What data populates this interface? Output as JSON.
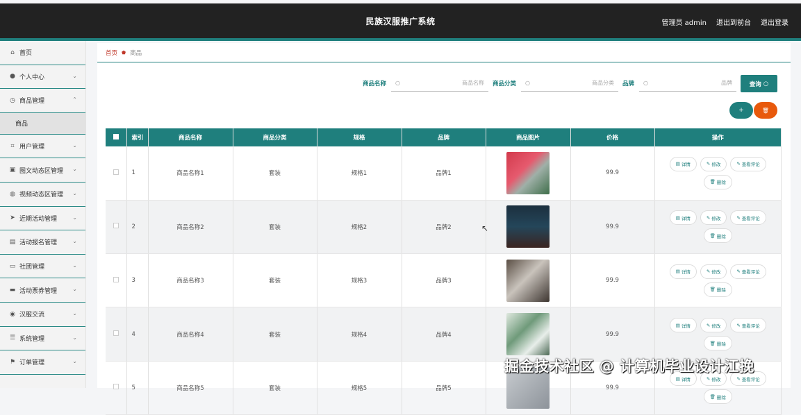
{
  "header": {
    "title": "民族汉服推广系统",
    "admin": "管理员 admin",
    "exit_front": "退出到前台",
    "logout": "退出登录"
  },
  "sidebar": {
    "items": [
      {
        "label": "首页",
        "icon": "home-icon",
        "glyph": "⌂",
        "chevron": false
      },
      {
        "label": "个人中心",
        "icon": "user-icon",
        "glyph": "●",
        "chevron": true
      },
      {
        "label": "商品管理",
        "icon": "clock-icon",
        "glyph": "◷",
        "chevron": true,
        "open": true
      },
      {
        "label": "用户管理",
        "icon": "crop-icon",
        "glyph": "⌗",
        "chevron": true
      },
      {
        "label": "图文动态区管理",
        "icon": "image-icon",
        "glyph": "▣",
        "chevron": true
      },
      {
        "label": "视频动态区管理",
        "icon": "globe-icon",
        "glyph": "◍",
        "chevron": true
      },
      {
        "label": "近期活动管理",
        "icon": "send-icon",
        "glyph": "➤",
        "chevron": true
      },
      {
        "label": "活动报名管理",
        "icon": "chart-icon",
        "glyph": "▤",
        "chevron": true
      },
      {
        "label": "社团管理",
        "icon": "chat-icon",
        "glyph": "▭",
        "chevron": true
      },
      {
        "label": "活动票券管理",
        "icon": "monitor-icon",
        "glyph": "▬",
        "chevron": true
      },
      {
        "label": "汉服交流",
        "icon": "mic-icon",
        "glyph": "◉",
        "chevron": true
      },
      {
        "label": "系统管理",
        "icon": "menu-icon",
        "glyph": "☰",
        "chevron": true
      },
      {
        "label": "订单管理",
        "icon": "flag-icon",
        "glyph": "⚑",
        "chevron": true
      }
    ],
    "sub_item": "商品"
  },
  "breadcrumb": {
    "home": "首页",
    "current": "商品"
  },
  "search": {
    "name_label": "商品名称",
    "name_placeholder": "商品名称",
    "category_label": "商品分类",
    "category_placeholder": "商品分类",
    "brand_label": "品牌",
    "brand_placeholder": "品牌",
    "query_button": "查询"
  },
  "actions": {
    "add": "+",
    "delete": "🗑"
  },
  "table": {
    "headers": [
      "索引",
      "商品名称",
      "商品分类",
      "规格",
      "品牌",
      "商品图片",
      "价格",
      "操作"
    ],
    "rows": [
      {
        "index": "1",
        "name": "商品名称1",
        "category": "套装",
        "spec": "规格1",
        "brand": "品牌1",
        "price": "99.9"
      },
      {
        "index": "2",
        "name": "商品名称2",
        "category": "套装",
        "spec": "规格2",
        "brand": "品牌2",
        "price": "99.9"
      },
      {
        "index": "3",
        "name": "商品名称3",
        "category": "套装",
        "spec": "规格3",
        "brand": "品牌3",
        "price": "99.9"
      },
      {
        "index": "4",
        "name": "商品名称4",
        "category": "套装",
        "spec": "规格4",
        "brand": "品牌4",
        "price": "99.9"
      },
      {
        "index": "5",
        "name": "商品名称5",
        "category": "套装",
        "spec": "规格5",
        "brand": "品牌5",
        "price": "99.9"
      }
    ],
    "op_labels": {
      "detail": "详情",
      "edit": "修改",
      "review": "查看评论",
      "remove": "删除"
    }
  },
  "watermark": "掘金技术社区 @ 计算机毕业设计江挽",
  "colors": {
    "accent": "#1f7f7d",
    "header": "#222222",
    "danger": "#e8590c"
  }
}
